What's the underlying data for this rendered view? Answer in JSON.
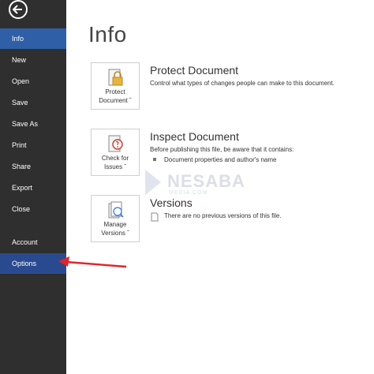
{
  "nav": {
    "items": [
      {
        "label": "Info"
      },
      {
        "label": "New"
      },
      {
        "label": "Open"
      },
      {
        "label": "Save"
      },
      {
        "label": "Save As"
      },
      {
        "label": "Print"
      },
      {
        "label": "Share"
      },
      {
        "label": "Export"
      },
      {
        "label": "Close"
      },
      {
        "label": "Account"
      },
      {
        "label": "Options"
      }
    ]
  },
  "page": {
    "title": "Info"
  },
  "protect": {
    "tile_line1": "Protect",
    "tile_line2": "Document ˇ",
    "title": "Protect Document",
    "desc": "Control what types of changes people can make to this document."
  },
  "inspect": {
    "tile_line1": "Check for",
    "tile_line2": "Issues ˇ",
    "title": "Inspect Document",
    "desc": "Before publishing this file, be aware that it contains:",
    "bullet": "Document properties and author's name"
  },
  "versions": {
    "tile_line1": "Manage",
    "tile_line2": "Versions ˇ",
    "title": "Versions",
    "desc": "There are no previous versions of this file."
  },
  "watermark": {
    "name": "NESABA",
    "sub": "MEDIA.COM"
  },
  "colors": {
    "sidebar": "#2f2f2f",
    "active": "#2f5fa6",
    "arrow": "#e0242a"
  }
}
